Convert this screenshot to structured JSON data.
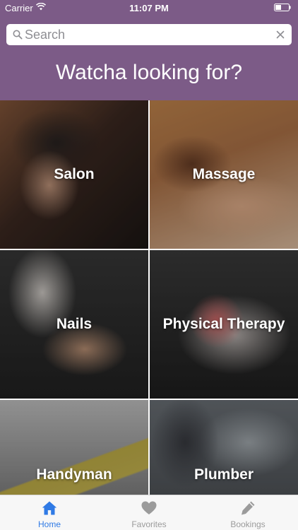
{
  "status_bar": {
    "carrier": "Carrier",
    "time": "11:07 PM"
  },
  "search": {
    "placeholder": "Search",
    "value": ""
  },
  "header": {
    "title": "Watcha looking for?"
  },
  "categories": [
    {
      "label": "Salon"
    },
    {
      "label": "Massage"
    },
    {
      "label": "Nails"
    },
    {
      "label": "Physical Therapy"
    },
    {
      "label": "Handyman"
    },
    {
      "label": "Plumber"
    }
  ],
  "tab_bar": {
    "tabs": [
      {
        "label": "Home",
        "icon": "home-icon",
        "active": true
      },
      {
        "label": "Favorites",
        "icon": "heart-icon",
        "active": false
      },
      {
        "label": "Bookings",
        "icon": "pencil-icon",
        "active": false
      }
    ]
  },
  "colors": {
    "header_bg": "#7c5b87",
    "tab_active": "#2f7ae5",
    "tab_inactive": "#9b9b9b"
  }
}
